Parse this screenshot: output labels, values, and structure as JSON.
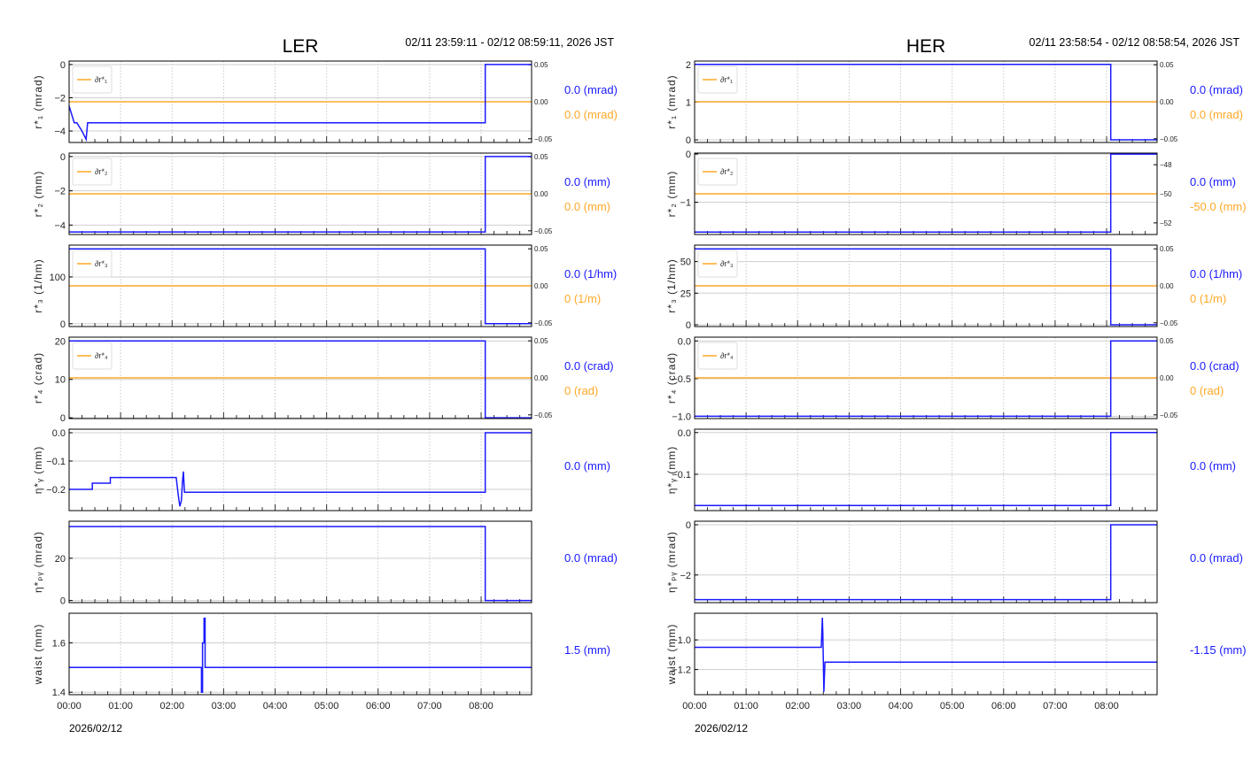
{
  "colors": {
    "blue": "#1a1aff",
    "orange": "#ffa826",
    "grid": "#cccccc"
  },
  "chart_data": [
    {
      "type": "line",
      "title": "LER",
      "time_range": "02/11 23:59:11 - 02/12 08:59:11, 2026 JST",
      "date_label": "2026/02/12",
      "xlim_hours": [
        0,
        8.98
      ],
      "xticks": [
        "00:00",
        "01:00",
        "02:00",
        "03:00",
        "04:00",
        "05:00",
        "06:00",
        "07:00",
        "08:00"
      ],
      "panels": [
        {
          "ylabel": "r*₁ (mrad)",
          "ylim": [
            -4.69,
            0.21
          ],
          "yticks": [
            0,
            -2,
            -4
          ],
          "ytick_labels": [
            "0",
            "−2",
            "−4"
          ],
          "series": {
            "x": [
              0,
              0.05,
              0.1,
              0.15,
              0.25,
              0.33,
              0.36,
              8.08,
              8.08,
              8.98
            ],
            "y": [
              -2.5,
              -3.0,
              -3.5,
              -3.5,
              -4.0,
              -4.5,
              -3.5,
              -3.5,
              0,
              0
            ]
          },
          "legend": "∂r*₁",
          "twin": {
            "ylim": [
              -0.055,
              0.055
            ],
            "yticks": [
              0.05,
              0.0,
              -0.05
            ],
            "ytick_labels": [
              "0.05",
              "0.00",
              "−0.05"
            ],
            "value": 0.0
          },
          "current": "0.0 (mrad)",
          "current_twin": "0.0 (mrad)"
        },
        {
          "ylabel": "r*₂ (mm)",
          "ylim": [
            -4.55,
            0.2
          ],
          "yticks": [
            0,
            -2,
            -4
          ],
          "ytick_labels": [
            "0",
            "−2",
            "−4"
          ],
          "series": {
            "x": [
              0,
              8.08,
              8.08,
              8.98
            ],
            "y": [
              -4.4,
              -4.4,
              0,
              0
            ]
          },
          "legend": "∂r*₂",
          "twin": {
            "ylim": [
              -0.055,
              0.055
            ],
            "yticks": [
              0.05,
              0.0,
              -0.05
            ],
            "ytick_labels": [
              "0.05",
              "0.00",
              "−0.05"
            ],
            "value": 0.0
          },
          "current": "0.0 (mm)",
          "current_twin": "0.0 (mm)"
        },
        {
          "ylabel": "r*₃ (1/hm)",
          "ylim": [
            -6,
            168
          ],
          "yticks": [
            100,
            0
          ],
          "ytick_labels": [
            "100",
            "0"
          ],
          "series": {
            "x": [
              0,
              8.08,
              8.08,
              8.98
            ],
            "y": [
              160,
              160,
              0,
              0
            ]
          },
          "legend": "∂r*₃",
          "twin": {
            "ylim": [
              -0.055,
              0.055
            ],
            "yticks": [
              0.05,
              0.0,
              -0.05
            ],
            "ytick_labels": [
              "0.05",
              "0.00",
              "−0.05"
            ],
            "value": 0.0
          },
          "current": "0.0 (1/hm)",
          "current_twin": "0 (1/m)"
        },
        {
          "ylabel": "r*₄ (crad)",
          "ylim": [
            -0.2,
            21
          ],
          "yticks": [
            20,
            10,
            0
          ],
          "ytick_labels": [
            "20",
            "10",
            "0"
          ],
          "series": {
            "x": [
              0,
              8.08,
              8.08,
              8.98
            ],
            "y": [
              20,
              20,
              0,
              0
            ]
          },
          "legend": "∂r*₄",
          "twin": {
            "ylim": [
              -0.055,
              0.055
            ],
            "yticks": [
              0.05,
              0.0,
              -0.05
            ],
            "ytick_labels": [
              "0.05",
              "0.00",
              "−0.05"
            ],
            "value": 0.0
          },
          "current": "0.0 (crad)",
          "current_twin": "0 (rad)"
        },
        {
          "ylabel": "η*ᵧ (mm)",
          "ylim": [
            -0.275,
            0.0125
          ],
          "yticks": [
            0.0,
            -0.1,
            -0.2
          ],
          "ytick_labels": [
            "0.0",
            "−0.1",
            "−0.2"
          ],
          "series": {
            "x": [
              0,
              0.45,
              0.45,
              0.8,
              0.8,
              2.08,
              2.12,
              2.15,
              2.18,
              2.2,
              2.22,
              2.24,
              8.08,
              8.08,
              8.98
            ],
            "y": [
              -0.2,
              -0.2,
              -0.178,
              -0.178,
              -0.158,
              -0.158,
              -0.22,
              -0.26,
              -0.24,
              -0.175,
              -0.137,
              -0.21,
              -0.21,
              0,
              0
            ]
          },
          "current": "0.0 (mm)"
        },
        {
          "ylabel": "η*ₚᵧ (mrad)",
          "ylim": [
            -1,
            37.5
          ],
          "yticks": [
            20,
            0
          ],
          "ytick_labels": [
            "20",
            "0"
          ],
          "series": {
            "x": [
              0,
              8.08,
              8.08,
              8.98
            ],
            "y": [
              35,
              35,
              0,
              0
            ]
          },
          "current": "0.0 (mrad)"
        },
        {
          "ylabel": "waist (mm)",
          "ylim": [
            1.39,
            1.72
          ],
          "yticks": [
            1.6,
            1.4
          ],
          "ytick_labels": [
            "1.6",
            "1.4"
          ],
          "series": {
            "x": [
              0,
              2.57,
              2.57,
              2.59,
              2.59,
              2.62,
              2.62,
              2.64,
              2.64,
              8.98
            ],
            "y": [
              1.5,
              1.5,
              1.4,
              1.4,
              1.6,
              1.6,
              1.7,
              1.7,
              1.5,
              1.5
            ]
          },
          "current": "1.5 (mm)"
        }
      ]
    },
    {
      "type": "line",
      "title": "HER",
      "time_range": "02/11 23:58:54 - 02/12 08:58:54, 2026 JST",
      "date_label": "2026/02/12",
      "xlim_hours": [
        0,
        8.98
      ],
      "xticks": [
        "00:00",
        "01:00",
        "02:00",
        "03:00",
        "04:00",
        "05:00",
        "06:00",
        "07:00",
        "08:00"
      ],
      "panels": [
        {
          "ylabel": "r*₁ (mrad)",
          "ylim": [
            -0.07,
            2.09
          ],
          "yticks": [
            2,
            1,
            0
          ],
          "ytick_labels": [
            "2",
            "1",
            "0"
          ],
          "series": {
            "x": [
              0,
              8.08,
              8.08,
              8.98
            ],
            "y": [
              2,
              2,
              0,
              0
            ]
          },
          "legend": "∂r*₁",
          "twin": {
            "ylim": [
              -0.055,
              0.055
            ],
            "yticks": [
              0.05,
              0.0,
              -0.05
            ],
            "ytick_labels": [
              "0.05",
              "0.00",
              "−0.05"
            ],
            "value": 0.0
          },
          "current": "0.0 (mrad)",
          "current_twin": "0.0 (mrad)"
        },
        {
          "ylabel": "r*₂ (mm)",
          "ylim": [
            -1.67,
            0.02
          ],
          "yticks": [
            0,
            -1
          ],
          "ytick_labels": [
            "0",
            "−1"
          ],
          "series": {
            "x": [
              0,
              8.08,
              8.08,
              8.98
            ],
            "y": [
              -1.62,
              -1.62,
              0,
              0
            ]
          },
          "legend": "∂r*₂",
          "twin": {
            "ylim": [
              -52.8,
              -47.2
            ],
            "yticks": [
              -48,
              -50,
              -52
            ],
            "ytick_labels": [
              "−48",
              "−50",
              "−52"
            ],
            "value": -50.0
          },
          "current": "0.0 (mm)",
          "current_twin": "-50.0 (mm)"
        },
        {
          "ylabel": "r*₃ (1/hm)",
          "ylim": [
            -1.4,
            63
          ],
          "yticks": [
            50,
            25,
            0
          ],
          "ytick_labels": [
            "50",
            "25",
            "0"
          ],
          "series": {
            "x": [
              0,
              8.08,
              8.08,
              8.98
            ],
            "y": [
              60,
              60,
              0,
              0
            ]
          },
          "legend": "∂r*₃",
          "twin": {
            "ylim": [
              -0.055,
              0.055
            ],
            "yticks": [
              0.05,
              0.0,
              -0.05
            ],
            "ytick_labels": [
              "0.05",
              "0.00",
              "−0.05"
            ],
            "value": 0.0
          },
          "current": "0.0 (1/hm)",
          "current_twin": "0 (1/m)"
        },
        {
          "ylabel": "r*₄ (crad)",
          "ylim": [
            -1.03,
            0.05
          ],
          "yticks": [
            0.0,
            -0.5,
            -1.0
          ],
          "ytick_labels": [
            "0.0",
            "−0.5",
            "−1.0"
          ],
          "series": {
            "x": [
              0,
              8.08,
              8.08,
              8.98
            ],
            "y": [
              -1,
              -1,
              0,
              0
            ]
          },
          "legend": "∂r*₄",
          "twin": {
            "ylim": [
              -0.055,
              0.055
            ],
            "yticks": [
              0.05,
              0.0,
              -0.05
            ],
            "ytick_labels": [
              "0.05",
              "0.00",
              "−0.05"
            ],
            "value": 0.0
          },
          "current": "0.0 (crad)",
          "current_twin": "0 (rad)"
        },
        {
          "ylabel": "η*ᵧ (mm)",
          "ylim": [
            -0.187,
            0.008
          ],
          "yticks": [
            0.0,
            -0.1
          ],
          "ytick_labels": [
            "0.0",
            "−0.1"
          ],
          "series": {
            "x": [
              0,
              8.08,
              8.08,
              8.98
            ],
            "y": [
              -0.175,
              -0.175,
              0,
              0
            ]
          },
          "current": "0.0 (mm)"
        },
        {
          "ylabel": "η*ₚᵧ (mrad)",
          "ylim": [
            -3.1,
            0.14
          ],
          "yticks": [
            0,
            -2
          ],
          "ytick_labels": [
            "0",
            "−2"
          ],
          "series": {
            "x": [
              0,
              8.08,
              8.08,
              8.98
            ],
            "y": [
              -2.98,
              -2.98,
              0,
              0
            ]
          },
          "current": "0.0 (mrad)"
        },
        {
          "ylabel": "waist (mm)",
          "ylim": [
            -1.37,
            -0.82
          ],
          "yticks": [
            -1.0,
            -1.2
          ],
          "ytick_labels": [
            "−1.0",
            "−1.2"
          ],
          "series": {
            "x": [
              0,
              2.46,
              2.47,
              2.48,
              2.49,
              2.5,
              2.51,
              2.52,
              2.53,
              8.98
            ],
            "y": [
              -1.05,
              -1.05,
              -0.95,
              -0.85,
              -0.95,
              -1.15,
              -1.35,
              -1.25,
              -1.15,
              -1.15
            ]
          },
          "current": "-1.15 (mm)"
        }
      ]
    }
  ]
}
